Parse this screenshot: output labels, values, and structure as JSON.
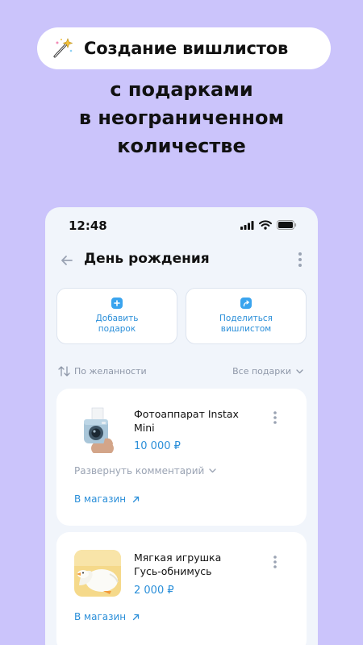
{
  "promo": {
    "title": "Создание вишлистов",
    "subtitle_line1": "с подарками",
    "subtitle_line2": "в неограниченном",
    "subtitle_line3": "количестве"
  },
  "status_bar": {
    "time": "12:48"
  },
  "header": {
    "title": "День рождения"
  },
  "actions": {
    "add_gift_line1": "Добавить",
    "add_gift_line2": "подарок",
    "share_line1": "Поделиться",
    "share_line2": "вишлистом"
  },
  "filters": {
    "sort_label": "По желанности",
    "category_label": "Все подарки"
  },
  "gifts": [
    {
      "name_line1": "Фотоаппарат Instax",
      "name_line2": "Mini",
      "price": "10 000 ₽",
      "expand_comment": "Развернуть комментарий",
      "store_link": "В магазин"
    },
    {
      "name_line1": "Мягкая игрушка",
      "name_line2": "Гусь-обнимусь",
      "price": "2 000 ₽",
      "store_link": "В магазин"
    }
  ],
  "colors": {
    "background": "#cbc4fb",
    "accent": "#2b8fd9",
    "icon_accent": "#3aa4ee"
  }
}
